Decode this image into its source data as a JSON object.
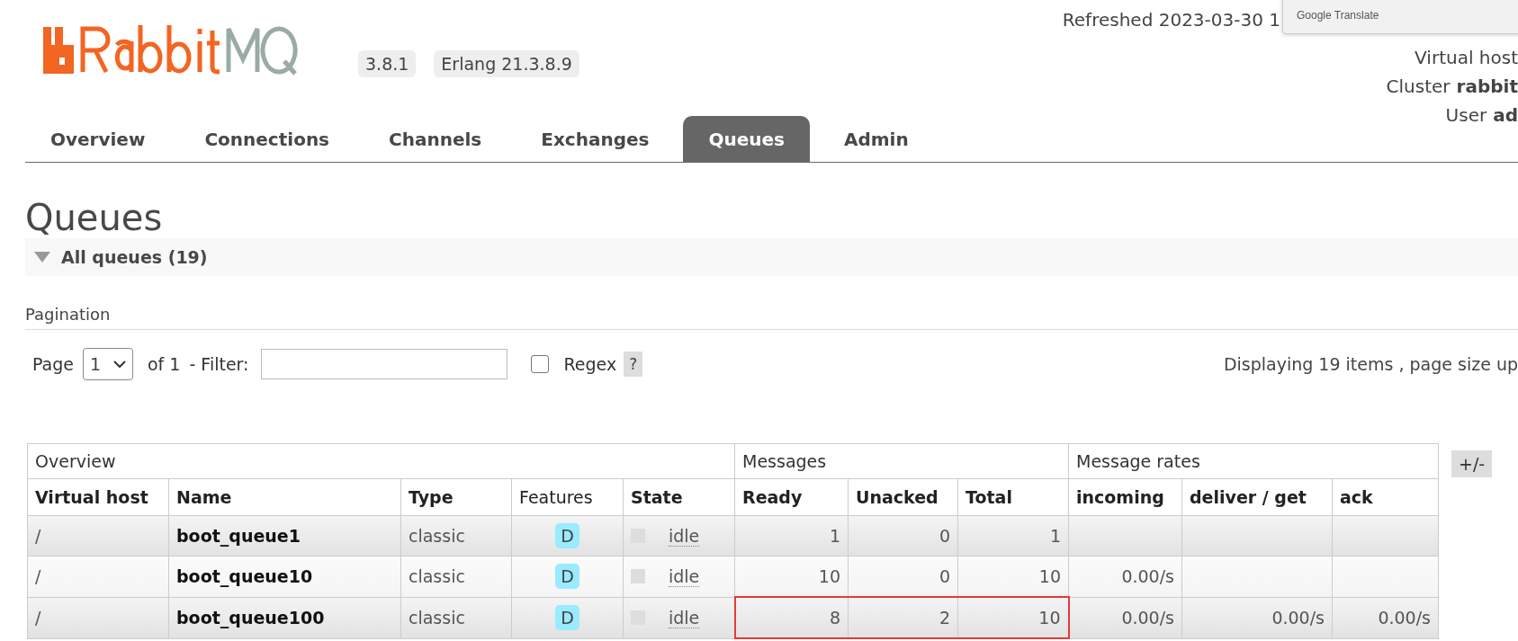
{
  "header": {
    "version": "3.8.1",
    "erlang": "Erlang 21.3.8.9",
    "refreshed": "Refreshed 2023-03-30 1",
    "virtual_host_label": "Virtual host",
    "cluster_label": "Cluster",
    "cluster_value": "rabbit",
    "user_label": "User",
    "user_value": "ad"
  },
  "translate_popup": {
    "label": "Google Translate"
  },
  "tabs": [
    {
      "label": "Overview",
      "selected": false
    },
    {
      "label": "Connections",
      "selected": false
    },
    {
      "label": "Channels",
      "selected": false
    },
    {
      "label": "Exchanges",
      "selected": false
    },
    {
      "label": "Queues",
      "selected": true
    },
    {
      "label": "Admin",
      "selected": false
    }
  ],
  "page_title": "Queues",
  "section": {
    "title": "All queues (19)",
    "expanded": true
  },
  "pagination": {
    "title": "Pagination",
    "page_label": "Page",
    "page_value": "1",
    "of_label": "of 1",
    "filter_label": "- Filter:",
    "regex_label": "Regex",
    "regex_checked": false,
    "help": "?",
    "displaying": "Displaying 19 items , page size up"
  },
  "table": {
    "groups": [
      {
        "label": "Overview"
      },
      {
        "label": "Messages"
      },
      {
        "label": "Message rates"
      }
    ],
    "columns": [
      {
        "label": "Virtual host",
        "bold": true
      },
      {
        "label": "Name",
        "bold": true
      },
      {
        "label": "Type",
        "bold": true
      },
      {
        "label": "Features",
        "bold": false
      },
      {
        "label": "State",
        "bold": true
      },
      {
        "label": "Ready",
        "bold": true
      },
      {
        "label": "Unacked",
        "bold": true
      },
      {
        "label": "Total",
        "bold": true
      },
      {
        "label": "incoming",
        "bold": true
      },
      {
        "label": "deliver / get",
        "bold": true
      },
      {
        "label": "ack",
        "bold": true
      }
    ],
    "toggle": "+/-",
    "rows": [
      {
        "vhost": "/",
        "name": "boot_queue1",
        "type": "classic",
        "feature": "D",
        "state": "idle",
        "ready": "1",
        "unacked": "0",
        "total": "1",
        "highlighted": false
      },
      {
        "vhost": "/",
        "name": "boot_queue10",
        "type": "classic",
        "feature": "D",
        "state": "idle",
        "ready": "10",
        "unacked": "0",
        "total": "10",
        "incoming": "0.00/s",
        "highlighted": false
      },
      {
        "vhost": "/",
        "name": "boot_queue100",
        "type": "classic",
        "feature": "D",
        "state": "idle",
        "ready": "8",
        "unacked": "2",
        "total": "10",
        "incoming": "0.00/s",
        "deliver": "0.00/s",
        "ack": "0.00/s",
        "highlighted": true
      }
    ]
  }
}
